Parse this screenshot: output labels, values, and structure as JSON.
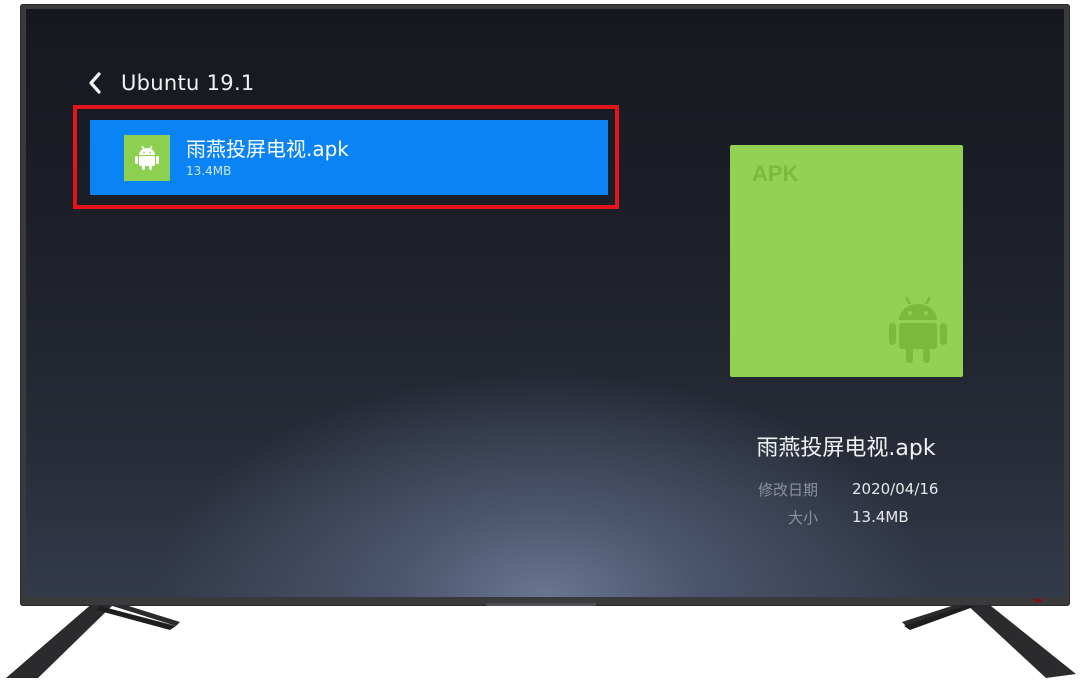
{
  "screen": {
    "header": {
      "back_icon": "chevron-left-icon",
      "title": "Ubuntu 19.1"
    },
    "file_list": [
      {
        "name": "雨燕投屏电视.apk",
        "size": "13.4MB",
        "icon": "android-icon",
        "selected": true
      }
    ],
    "preview": {
      "type_label": "APK",
      "icon": "android-icon",
      "title": "雨燕投屏电视.apk",
      "details": [
        {
          "label": "修改日期",
          "value": "2020/04/16"
        },
        {
          "label": "大小",
          "value": "13.4MB"
        }
      ]
    }
  },
  "colors": {
    "selection": "#0a84f5",
    "highlight_border": "#e4141b",
    "apk_green": "#92d152"
  }
}
